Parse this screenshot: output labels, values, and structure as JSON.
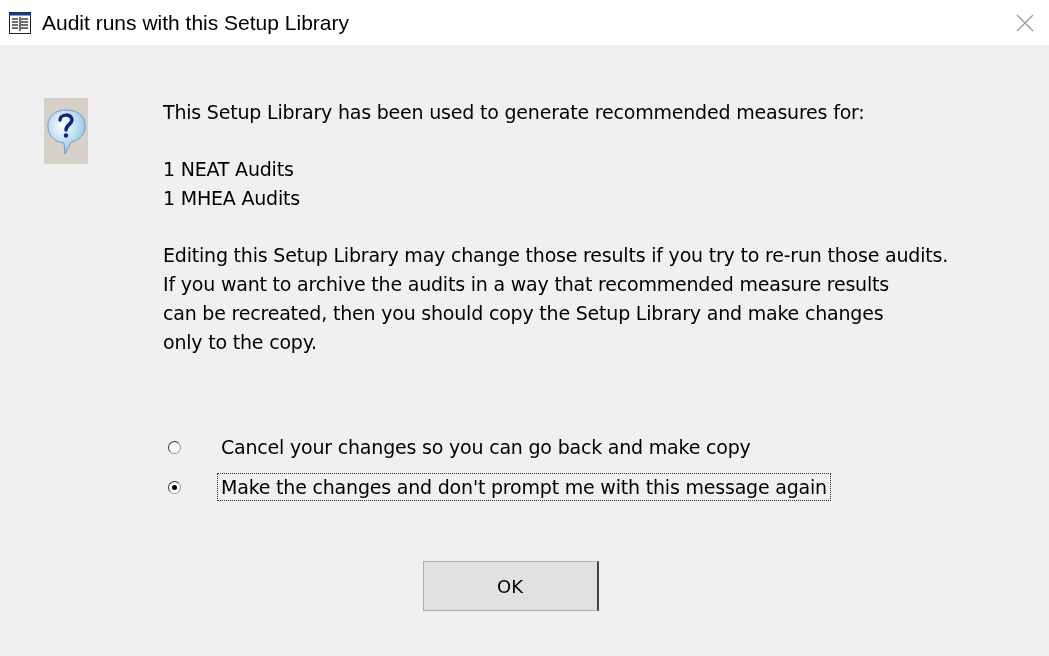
{
  "window": {
    "title": "Audit runs with this Setup Library"
  },
  "message": {
    "intro": "This Setup Library has been used to generate recommended measures for:",
    "counts": [
      "1 NEAT Audits",
      "1 MHEA Audits"
    ],
    "warning": [
      "Editing this Setup Library may change those results if you try to re-run those audits.",
      "If you want to archive the audits in a way that recommended measure results",
      "can be recreated, then you should copy the Setup Library and make changes",
      "only to the copy."
    ]
  },
  "options": [
    {
      "label": "Cancel your changes so you can go back and make copy",
      "selected": false,
      "focused": false
    },
    {
      "label": "Make the changes and don't prompt me with this message again",
      "selected": true,
      "focused": true
    }
  ],
  "buttons": [
    "OK"
  ]
}
